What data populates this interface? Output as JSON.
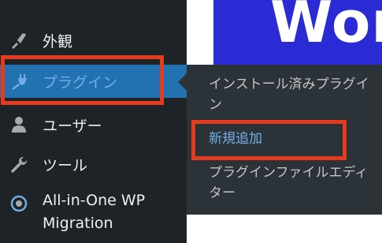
{
  "sidebar": {
    "items": [
      {
        "label": "外観",
        "icon": "paintbrush-icon"
      },
      {
        "label": "プラグイン",
        "icon": "plugin-icon",
        "active": true
      },
      {
        "label": "ユーザー",
        "icon": "user-icon"
      },
      {
        "label": "ツール",
        "icon": "wrench-icon"
      },
      {
        "label_line1": "All-in-One WP",
        "label_line2": "Migration",
        "icon": "migration-icon"
      }
    ]
  },
  "submenu": {
    "installed": "インストール済みプラグイン",
    "add_new": "新規追加",
    "editor": "プラグインファイルエディター"
  },
  "banner": {
    "text": "Word"
  },
  "colors": {
    "sidebar_bg": "#1d2327",
    "submenu_bg": "#2c3338",
    "active_bg": "#2271b1",
    "link_blue": "#72aee6",
    "highlight_red": "#e63a1e",
    "banner_blue": "#2b2bd6"
  }
}
